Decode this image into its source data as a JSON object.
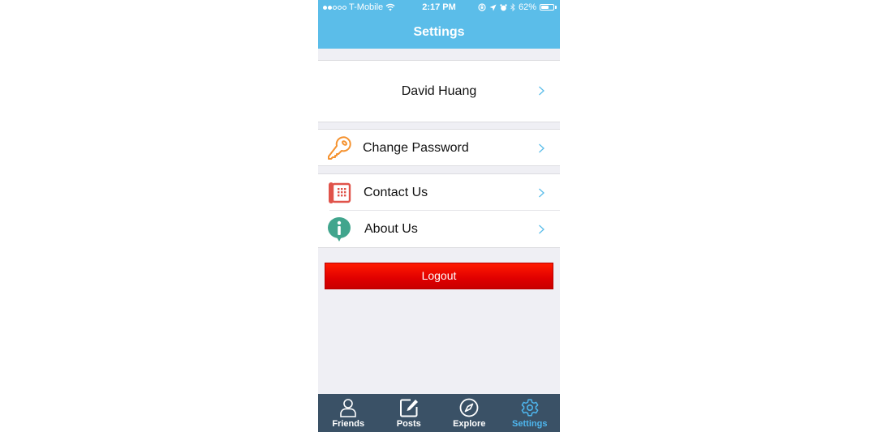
{
  "status_bar": {
    "signal_dots_filled": 2,
    "signal_dots_total": 5,
    "carrier": "T-Mobile",
    "time": "2:17 PM",
    "battery_percent_label": "62%",
    "battery_level": 0.62
  },
  "nav": {
    "title": "Settings"
  },
  "profile": {
    "name": "David Huang"
  },
  "menu": {
    "change_password": {
      "label": "Change Password",
      "icon": "key-icon",
      "color": "#f5922f"
    },
    "contact_us": {
      "label": "Contact Us",
      "icon": "phone-icon",
      "color": "#e0534a"
    },
    "about_us": {
      "label": "About Us",
      "icon": "info-icon",
      "color": "#41a58d"
    }
  },
  "logout": {
    "label": "Logout"
  },
  "tabs": [
    {
      "label": "Friends",
      "icon": "person-icon",
      "active": false
    },
    {
      "label": "Posts",
      "icon": "compose-icon",
      "active": false
    },
    {
      "label": "Explore",
      "icon": "compass-icon",
      "active": false
    },
    {
      "label": "Settings",
      "icon": "gear-icon",
      "active": true
    }
  ],
  "colors": {
    "accent": "#5bbde9",
    "tab_bar": "#3a5166",
    "tab_active": "#4eb6ee",
    "logout": "#e00000",
    "background": "#efeff4"
  }
}
